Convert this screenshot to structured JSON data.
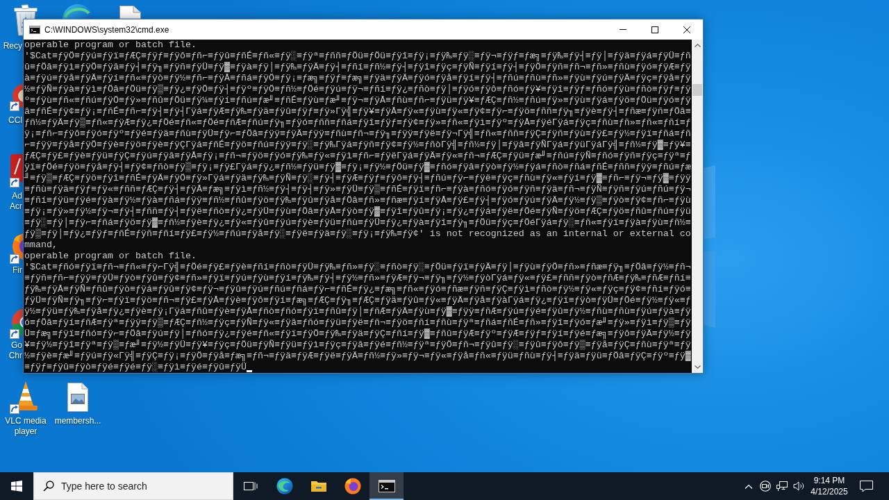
{
  "desktop": {
    "icons": [
      {
        "kind": "recycle-bin",
        "label_lines": [
          "Recy"
        ]
      },
      {
        "kind": "edge"
      },
      {
        "kind": "document"
      },
      {
        "kind": "ccleaner",
        "label_lines": [
          "CCl"
        ]
      },
      {
        "kind": "acrobat",
        "label_lines": [
          "Ad",
          "Acr"
        ]
      },
      {
        "kind": "firefox",
        "label_lines": [
          "Fir"
        ]
      },
      {
        "kind": "chrome",
        "label_lines": [
          "Go",
          "Chr"
        ]
      },
      {
        "kind": "vlc",
        "label": "VLC media player"
      },
      {
        "kind": "image-file",
        "label": "membersh..."
      }
    ]
  },
  "window": {
    "title": "C:\\WINDOWS\\system32\\cmd.exe",
    "cursor": true,
    "lines": [
      "operable program or batch file.",
      "'$Cat≡ƒÿÖ≡ƒÿú≡ƒÿï≡ƒÆÇ≡ƒÿƒ≡ƒÿô≡ƒñ⌐≡ƒÿû≡ƒñÉ≡ƒñ«≡ƒÿ░≡ƒÿª≡ƒññ≡ƒÖü≡ƒÖü≡ƒÿî≡ƒÿ¡≡ƒÿ₧≡ƒÿ░≡ƒÿ¬≡ƒÿƒ≡ƒæ╗≡ƒÿ₧≡ƒÿ┤≡ƒÿ│≡ƒÿä≡ƒÿá≡ƒÿÜ≡ƒñ",
      "û≡ƒÖâ≡ƒÿì≡ƒÿÖ≡ƒÿâ≡ƒÿ┤≡ƒÿ╖≡ƒÿñ≡ƒÿÜ≡ƒÿ▓≡ƒÿà≡ƒÿ│≡ƒÿ₧≡ƒÿÄ≡ƒÿ┤≡ƒñí≡ƒñ½≡ƒÿ┤≡ƒÿî≡ƒÿç≡ƒÿÑ≡ƒÿí≡ƒÿ┤≡ƒÿÖ≡ƒÿñ≡ƒñ¬≡ƒñ»≡ƒñù≡ƒÿó≡ƒÿÆ≡ƒÿ",
      "à≡ƒÿú≡ƒÿå≡ƒÿÄ≡ƒÿí≡ƒñ«≡ƒÿò≡ƒÿ½≡ƒñ⌐≡ƒÿÅ≡ƒñá≡ƒÿÖ≡ƒÿ¡≡ƒæ╗≡ƒÿƒ≡ƒæ╗≡ƒÿä≡ƒÿÄ≡ƒÿó≡ƒÿå≡ƒÿí≡ƒÿ┤≡ƒñú≡ƒñù≡ƒñ»≡ƒÿù≡ƒÿú≡ƒÿÄ≡ƒÿç≡ƒÿå≡ƒÿ",
      "½≡ƒÿÑ≡ƒÿà≡ƒÿì≡ƒÖâ≡ƒÖü≡ƒÿ▒≡ƒÿ¿≡ƒÿÖ≡ƒÿ┤≡ƒÿº≡ƒÿÖ≡ƒñ½≡ƒÖé≡ƒÿú≡ƒÿ¬≡ƒñí≡ƒÿ¿≡ƒñò≡ƒÿ│≡ƒÿó≡ƒÿô≡ƒñó≡ƒÿ¥≡ƒÿî≡ƒÿƒ≡ƒñó≡ƒÿù≡ƒñò≡ƒÿƒ≡ƒÿ",
      "º≡ƒÿù≡ƒñ«≡ƒñú≡ƒÿÖ≡ƒÿ»≡ƒñû≡ƒÖü≡ƒÿ¼≡ƒÿí≡ƒñú≡ƒæ╜≡ƒñÉ≡ƒÿù≡ƒæ╜≡ƒÿ¬≡ƒÿÅ≡ƒñù≡ƒñ⌐≡ƒÿü≡ƒÿ¥≡ƒÆÇ≡ƒñ½≡ƒñú≡ƒÿ»≡ƒÿù≡ƒÿá≡ƒÿö≡ƒÖü≡ƒÿó≡ƒÿ",
      "â≡ƒñÉ≡ƒÿ¢≡ƒÿ¡≡ƒñÉ≡ƒñ⌐≡ƒÿ┤≡ƒÿ┤Γÿá≡ƒÿÆ≡ƒÿ₧≡ƒÿä≡ƒÿû≡ƒÿƒ≡ƒÿ»Γÿ╣≡ƒÿ¥≡ƒÿÅ≡ƒÿ«≡ƒÿù≡ƒÿ«≡ƒÿ¢≡ƒÿ⌐≡ƒÿö≡ƒññ≡ƒÿ╖≡ƒÿè≡ƒÿ┤≡ƒñæ≡ƒÿñ≡ƒÖâ≡",
      "ƒñ½≡ƒÿÄ≡ƒÿ▒≡ƒñ«≡ƒÿÆ≡ƒÿ¿≡ƒÖé≡ƒñ«≡ƒÖé≡ƒñÆ≡ƒñú≡ƒÿ╖≡ƒÿó≡ƒññ≡ƒñá≡ƒÿî≡ƒÿƒ≡ƒÿ¢≡ƒÿ»≡ƒñ«≡ƒÿì≡ƒÿº≡ƒÿÅ≡ƒÿéΓÿá≡ƒÿç≡ƒñù≡ƒñ»≡ƒñ«≡ƒñí≡ƒ",
      "ÿ¡≡ƒñ⌐≡ƒÿô≡ƒÿó≡ƒÿº≡ƒÿé≡ƒÿä≡ƒñù≡ƒÿÜ≡ƒÿ⌐≡ƒÖâ≡ƒÿÿ≡ƒÿÄ≡ƒÿÿ≡ƒñù≡ƒñ¬≡ƒÿ╖≡ƒÿÿ≡ƒÿë≡ƒÿ¬Γÿ╣≡ƒñ«≡ƒññ≡ƒÿÇ≡ƒÿñ≡ƒÿù≡ƒÿ£≡ƒÿ½≡ƒÿï≡ƒñá≡ƒñ",
      "⌐≡ƒÿÿ≡ƒÿå≡ƒÿÖ≡ƒÿè≡ƒÿö≡ƒÿè≡ƒÿÇΓÿá≡ƒñÉ≡ƒÿö≡ƒñú≡ƒÿÿ≡ƒÿ░≡ƒÿ₧Γÿá≡ƒÿñ≡ƒÿ¢≡ƒÿ½≡ƒñòΓÿ╣≡ƒñ½≡ƒÿ│≡ƒÿâ≡ƒÿÑΓÿá≡ƒÿüΓÿáΓÿ╣≡ƒñ½≡ƒÿ▓≡ƒÿ¥≡",
      "ƒÆÇ≡ƒÿ£≡ƒÿè≡ƒÿü≡ƒÿÇ≡ƒÿú≡ƒÿâ≡ƒÿÅ≡ƒÿ¡≡ƒñ¬≡ƒÿö≡ƒÿó≡ƒÿ₧≡ƒÿ«≡ƒÿì≡ƒñ⌐≡ƒÿëΓÿá≡ƒÿÄ≡ƒÿ«≡ƒñ¬≡ƒÆÇ≡ƒÿü≡ƒæ╜≡ƒñú≡ƒÿÑ≡ƒñó≡ƒÿñ≡ƒÿç≡ƒÿª≡ƒ",
      "ÿï≡ƒÖé≡ƒÿö≡ƒÿå≡ƒÿ┤≡ƒÿ¢≡ƒñò≡ƒÿ▒≡ƒÿ¡≡ƒÿ£Γÿá≡ƒÿ¿≡ƒñ½≡ƒÿü≡ƒÿ▓≡ƒÿ¡≡ƒÿ½≡ƒÖü≡ƒÿ▓≡ƒñó≡ƒÿâ≡ƒÿò≡ƒÿ½≡ƒÿá≡ƒñò≡ƒñá≡ƒñÉ≡ƒññ≡ƒÿÿ≡ƒñú≡ƒæ",
      "╜≡ƒÿ▒≡ƒÆÇ≡ƒÿö≡ƒÿî≡ƒñÉ≡ƒÿÄ≡ƒÿÖ≡ƒÿ»Γÿá≡ƒÿä≡ƒÿ₧≡ƒÿÑ≡ƒÿ░≡ƒÿ┤≡ƒÿÆ≡ƒÿƒ≡ƒÿô≡ƒÿ┤≡ƒñú≡ƒÿ⌐≡ƒÿë≡ƒÿç≡ƒñù≡ƒÿ«≡ƒÿí≡ƒÿ▓≡ƒñ⌐≡ƒÿ¬≡ƒÿ▓≡ƒÿÿ",
      "≡ƒñù≡ƒÿä≡ƒÿƒ≡ƒÿ«≡ƒññ≡ƒÆÇ≡ƒÿ┤≡ƒÿÅ≡ƒæ╗≡ƒÿì≡ƒñ½≡ƒÿ┤≡ƒÿ┤≡ƒÿ»≡ƒÿÜ≡ƒÿ▒≡ƒñÉ≡ƒÿï≡ƒñ⌐≡ƒÿà≡ƒñó≡ƒÿó≡ƒÿñ≡ƒÿä≡ƒñ¬≡ƒÿÑ≡ƒÿñ≡ƒÿú≡ƒñú≡ƒÿ¬",
      "≡ƒñí≡ƒÿü≡ƒÿé≡ƒÿà≡ƒÿ½≡ƒÿà≡ƒñá≡ƒÿÿ≡ƒñ½≡ƒñû≡ƒÿö≡ƒÿ₧≡ƒÿû≡ƒÿå≡ƒÖâ≡ƒñ»≡ƒñæ≡ƒÿí≡ƒÿÅ≡ƒÿ£≡ƒÿ┤≡ƒÿó≡ƒÿú≡ƒÿÄ≡ƒÿ½≡ƒÿ▒≡ƒÿò≡ƒÿ¢≡ƒñ⌐≡ƒÿù",
      "≡ƒÿ¡≡ƒÿ»≡ƒÿ½≡ƒÿ¬≡ƒÿ┤≡ƒññ≡ƒÿ┤≡ƒÿë≡ƒñò≡ƒÿ¿≡ƒÿÜ≡ƒÿù≡ƒÖâ≡ƒÿÅ≡ƒÿò≡ƒÿ▓≡ƒÿî≡ƒÿû≡ƒÿ¡≡ƒÿ¿≡ƒÿá≡ƒÿë≡ƒÖé≡ƒÿÑ≡ƒÿö≡ƒÆÇ≡ƒÿö≡ƒñû≡ƒñú≡ƒÿü",
      "≡ƒÿ░≡ƒÿ│≡ƒÿ⌐≡ƒñá≡ƒÿö≡ƒÿ▓≡ƒñ½≡ƒÿè≡ƒÿ¿≡ƒÿ«≡ƒÿû≡ƒÿú≡ƒÿè≡ƒÿü≡ƒñù≡ƒÿÜ≡ƒÿ¿≡ƒÿà≡ƒÿî≡ƒÿ╖≡ƒÖü≡ƒÿç≡ƒÖéΓÿá≡ƒÿ░≡ƒñ«≡ƒÿï≡ƒÿà≡ƒÿù≡ƒñ½≡",
      "ƒÿ▒≡ƒÿ│≡ƒÿ¿≡ƒÿƒ≡ƒñÉ≡ƒÿñ≡ƒñí≡ƒÿ£≡ƒÿ½≡ƒñú≡ƒÿå≡ƒÿ░≡ƒÿë≡ƒÿä≡ƒÿ░≡ƒÿ¡≡ƒÿ₧≡ƒÿ¢' is not recognized as an internal or external co",
      "mmand,",
      "operable program or batch file.",
      "'$Cat≡ƒñó≡ƒÿï≡ƒñ¬≡ƒñ«≡ƒÿ⌐Γÿ╣≡ƒÖé≡ƒÿ£≡ƒÿè≡ƒñí≡ƒñò≡ƒÿÜ≡ƒÿ₧≡ƒñ»≡ƒÿ░≡ƒñò≡ƒÿ░≡ƒÖü≡ƒÿï≡ƒÿÄ≡ƒÿ│≡ƒÿù≡ƒÿÖ≡ƒñ»≡ƒñæ≡ƒÿ╖≡ƒÖâ≡ƒÿ½≡ƒñ¬",
      "≡ƒÿñ≡ƒñ⌐≡ƒÿÿ≡ƒÿÜ≡ƒÿò≡ƒÿû≡ƒÿ¢≡ƒñ»≡ƒÿï≡ƒÿú≡ƒÿù≡ƒÿí≡ƒÿ₧≡ƒÿ┤≡ƒÿ½≡ƒñ»≡ƒÿÆ≡ƒÿ¬≡ƒÿ╖≡ƒÿ½≡ƒÿòΓÿá≡ƒÿ«≡ƒÿ£≡ƒññ≡ƒÿò≡ƒñÆ≡ƒÿ₧≡ƒñÆ≡ƒñí≡",
      "ƒÿ₧≡ƒÿÅ≡ƒÿÑ≡ƒñû≡ƒÿò≡ƒÿá≡ƒÿû≡ƒÿ¢≡ƒÿ¬≡ƒÿû≡ƒÿú≡ƒñú≡ƒñá≡ƒÿ⌐≡ƒñÉ≡ƒÿ¿≡ƒæ╗≡ƒñ«≡ƒÿó≡ƒñæ≡ƒÿñ≡ƒÿÇ≡ƒÿì≡ƒñò≡ƒÿ½≡ƒÿ«≡ƒÿç≡ƒÿ¢≡ƒñí≡ƒÿó≡",
      "ƒÿÜ≡ƒÿÑ≡ƒÿ╖≡ƒÿ⌐≡ƒÿï≡ƒÿö≡ƒñ¬≡ƒÿ£≡ƒÿÅ≡ƒÿè≡ƒÿô≡ƒÿí≡ƒæ╗≡ƒÆÇ≡ƒÿ╖≡ƒÆÇ≡ƒÿä≡ƒÿû≡ƒÿ«≡ƒÿÄ≡ƒÿå≡ƒÿàΓÿá≡ƒÿ¿≡ƒÿï≡ƒÿò≡ƒÿÜ≡ƒÖé≡ƒÿ½≡ƒÿ«≡ƒ",
      "ÿ½≡ƒÿü≡ƒÿ₧≡ƒÿå≡ƒÿ¿≡ƒÿè≡ƒÿ¡Γÿá≡ƒñû≡ƒÿè≡ƒÿÅ≡ƒñò≡ƒñó≡ƒÿï≡ƒñû≡ƒÿ│≡ƒñÆ≡ƒÿÄ≡ƒÿù≡ƒÿ▓≡ƒÿÿ≡ƒñÆ≡ƒÿú≡ƒÿé≡ƒÿû≡ƒÿ½≡ƒñù≡ƒñù≡ƒÿú≡ƒÿà≡ƒÿ",
      "ó≡ƒÖâ≡ƒÿí≡ƒñÆ≡ƒÿª≡ƒÿÿ≡ƒÿ▒≡ƒÆÇ≡ƒñ½≡ƒÿç≡ƒÿÑ≡ƒÿ«≡ƒÿâ≡ƒñó≡ƒÿü≡ƒÿë≡ƒñ¬≡ƒÿö≡ƒñí≡ƒñù≡ƒÿª≡ƒñá≡ƒñÉ≡ƒñ»≡ƒÿî≡ƒÿó≡ƒæ╜≡ƒÿ»≡ƒÿì≡ƒÿ▒≡ƒÿ",
      "Ü≡ƒæ╗≡ƒÿï≡ƒñó≡ƒÿ⌐≡ƒÖâ≡ƒÿú≡ƒÿ│≡ƒñó≡ƒÿ¿≡ƒÿé≡ƒñ«≡ƒÿï≡ƒÿÖ≡ƒÿ₧≡ƒÿä≡ƒÿÇ≡ƒñí≡ƒÿ▓≡ƒñû≡ƒÿÆ≡ƒÿº≡ƒÿÆ≡ƒÿƒ≡ƒÿí≡ƒÿé≡ƒæ╗≡ƒÿô≡ƒÿÄ≡ƒÿ½≡ƒÿ",
      "¥≡ƒÿ½≡ƒÿî≡ƒÿª≡ƒÿ▒≡ƒæ╜≡ƒÿ½≡ƒÿÜ≡ƒÿ¥≡ƒÿç≡ƒÖü≡ƒÿÑ≡ƒÿü≡ƒÿì≡ƒÿç≡ƒÿâ≡ƒÿé≡ƒñ½≡ƒÿª≡ƒÿÖ≡ƒñ¬≡ƒÿû≡ƒÿ░≡ƒÿû≡ƒÿô≡ƒÿ▒≡ƒÿå≡ƒÿÇ≡ƒñù≡ƒÿª≡ƒÿ",
      "½≡ƒÿè≡ƒæ╜≡ƒÿú≡ƒÿ«Γÿ╣≡ƒÿÇ≡ƒÿ¡≡ƒÿÖ≡ƒÿå≡ƒæ╗≡ƒñ¬≡ƒÿä≡ƒÿÆ≡ƒÿë≡ƒÿÄ≡ƒñ½≡ƒÿ»≡ƒÿ¬≡ƒÿ«≡ƒÿå≡ƒñ«≡ƒÿü≡ƒñù≡ƒÿ┤≡ƒÿä≡ƒÿü≡ƒÖâ≡ƒÿÇ≡ƒÿº≡ƒÿ▓",
      "≡ƒÿƒ≡ƒÿû≡ƒÿò≡ƒÿé≡ƒÿé≡ƒÿ░≡ƒÿì≡ƒÿé≡ƒÿû≡ƒÿÜ"
    ]
  },
  "taskbar": {
    "search": {
      "placeholder": "Type here to search"
    },
    "apps": [
      {
        "kind": "task-view",
        "active": false
      },
      {
        "kind": "edge",
        "active": false
      },
      {
        "kind": "explorer",
        "active": false
      },
      {
        "kind": "firefox",
        "active": false
      },
      {
        "kind": "console",
        "active": true
      }
    ],
    "clock": {
      "time": "9:14 PM",
      "date": "4/12/2025"
    }
  }
}
